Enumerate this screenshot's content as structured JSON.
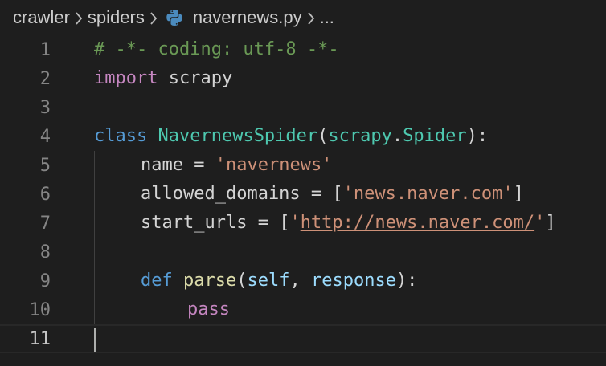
{
  "breadcrumb": {
    "items": [
      "crawler",
      "spiders",
      "navernews.py",
      "..."
    ],
    "separator_icon": "chevron-right-icon",
    "file_icon": "python-icon"
  },
  "editor": {
    "line_numbers": [
      "1",
      "2",
      "3",
      "4",
      "5",
      "6",
      "7",
      "8",
      "9",
      "10",
      "11"
    ],
    "lines": {
      "l1": {
        "comment": "# -*- coding: utf-8 -*-"
      },
      "l2": {
        "kw": "import",
        "sp": " ",
        "mod": "scrapy"
      },
      "l4": {
        "kw": "class",
        "sp": " ",
        "cls": "NavernewsSpider",
        "p1": "(",
        "base1": "scrapy",
        "dot": ".",
        "base2": "Spider",
        "p2": "):"
      },
      "l5": {
        "var": "name",
        "eq": " = ",
        "str": "'navernews'"
      },
      "l6": {
        "var": "allowed_domains",
        "eq": " = [",
        "str": "'news.naver.com'",
        "end": "]"
      },
      "l7": {
        "var": "start_urls",
        "eq": " = [",
        "q1": "'",
        "url": "http://news.naver.com/",
        "q2": "'",
        "end": "]"
      },
      "l9": {
        "kw": "def",
        "sp": " ",
        "fn": "parse",
        "p1": "(",
        "a1": "self",
        "comma": ", ",
        "a2": "response",
        "p2": "):"
      },
      "l10": {
        "kw": "pass"
      }
    },
    "current_line": "11"
  },
  "colors": {
    "background": "#1e1e1e",
    "comment": "#6a9955",
    "keyword_control": "#c586c0",
    "keyword_storage": "#569cd6",
    "class_name": "#4ec9b0",
    "variable": "#9cdcfe",
    "string": "#ce9178",
    "function": "#dcdcaa"
  }
}
